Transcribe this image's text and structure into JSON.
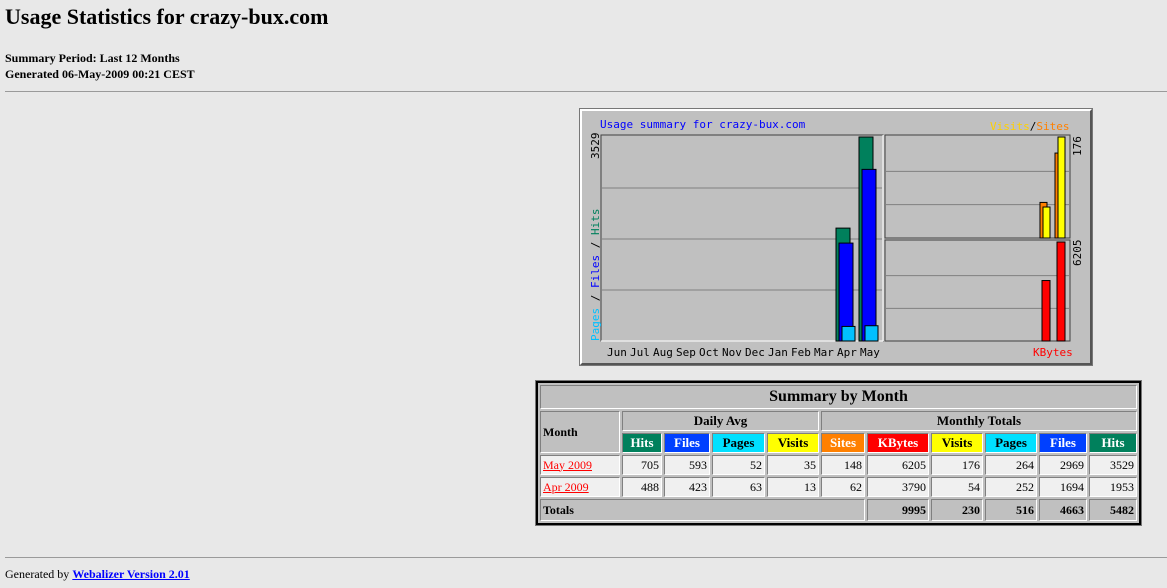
{
  "page": {
    "title": "Usage Statistics for crazy-bux.com",
    "summary_period": "Summary Period: Last 12 Months",
    "generated": "Generated 06-May-2009 00:21 CEST"
  },
  "graph": {
    "title": "Usage summary for crazy-bux.com",
    "legend_visits": "Visits",
    "legend_slash": "/",
    "legend_sites": "Sites",
    "legend_pages": "Pages",
    "legend_files": "Files",
    "legend_hits": "Hits",
    "legend_kbytes": "KBytes",
    "main_max": "3529",
    "visits_max": "176",
    "kbytes_max": "6205",
    "colors": {
      "hits": "#00805c",
      "files": "#0000ff",
      "pages": "#00c0ff",
      "visits": "#ffff00",
      "sites": "#ff8000",
      "kbytes": "#ff0000",
      "title": "#0000ff"
    }
  },
  "chart_data": {
    "type": "bar",
    "title": "Usage summary for crazy-bux.com",
    "categories": [
      "Jun",
      "Jul",
      "Aug",
      "Sep",
      "Oct",
      "Nov",
      "Dec",
      "Jan",
      "Feb",
      "Mar",
      "Apr",
      "May"
    ],
    "series": [
      {
        "name": "Hits",
        "values": [
          0,
          0,
          0,
          0,
          0,
          0,
          0,
          0,
          0,
          0,
          1953,
          3529
        ]
      },
      {
        "name": "Files",
        "values": [
          0,
          0,
          0,
          0,
          0,
          0,
          0,
          0,
          0,
          0,
          1694,
          2969
        ]
      },
      {
        "name": "Pages",
        "values": [
          0,
          0,
          0,
          0,
          0,
          0,
          0,
          0,
          0,
          0,
          252,
          264
        ]
      },
      {
        "name": "Visits",
        "values": [
          0,
          0,
          0,
          0,
          0,
          0,
          0,
          0,
          0,
          0,
          54,
          176
        ]
      },
      {
        "name": "Sites",
        "values": [
          0,
          0,
          0,
          0,
          0,
          0,
          0,
          0,
          0,
          0,
          62,
          148
        ]
      },
      {
        "name": "KBytes",
        "values": [
          0,
          0,
          0,
          0,
          0,
          0,
          0,
          0,
          0,
          0,
          3790,
          6205
        ]
      }
    ],
    "ylim_main": [
      0,
      3529
    ],
    "ylim_visits": [
      0,
      176
    ],
    "ylim_kbytes": [
      0,
      6205
    ],
    "grid": true
  },
  "table": {
    "caption": "Summary by Month",
    "month_header": "Month",
    "daily_avg_header": "Daily Avg",
    "monthly_totals_header": "Monthly Totals",
    "daily_cols": [
      "Hits",
      "Files",
      "Pages",
      "Visits"
    ],
    "monthly_cols": [
      "Sites",
      "KBytes",
      "Visits",
      "Pages",
      "Files",
      "Hits"
    ],
    "rows": [
      {
        "month": "May 2009",
        "values": [
          "705",
          "593",
          "52",
          "35",
          "148",
          "6205",
          "176",
          "264",
          "2969",
          "3529"
        ]
      },
      {
        "month": "Apr 2009",
        "values": [
          "488",
          "423",
          "63",
          "13",
          "62",
          "3790",
          "54",
          "252",
          "1694",
          "1953"
        ]
      }
    ],
    "totals_label": "Totals",
    "totals": [
      "9995",
      "230",
      "516",
      "4663",
      "5482"
    ]
  },
  "footer": {
    "prefix": "Generated by",
    "link": "Webalizer Version 2.01"
  }
}
